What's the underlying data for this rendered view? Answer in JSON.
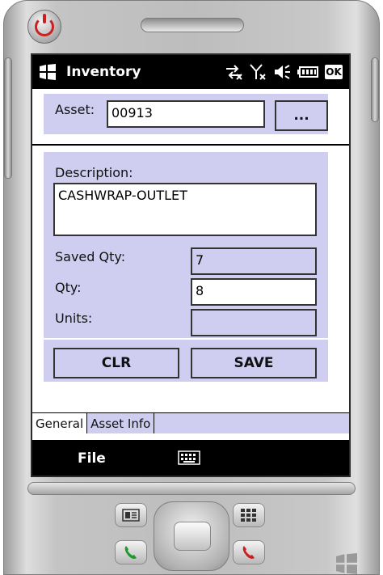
{
  "app": {
    "title": "Inventory",
    "ok_label": "OK"
  },
  "asset": {
    "label": "Asset:",
    "value": "00913",
    "browse_label": "..."
  },
  "description": {
    "label": "Description:",
    "value": "CASHWRAP-OUTLET"
  },
  "saved_qty": {
    "label": "Saved Qty:",
    "value": "7"
  },
  "qty": {
    "label": "Qty:",
    "value": "8"
  },
  "units": {
    "label": "Units:",
    "value": ""
  },
  "buttons": {
    "clr": "CLR",
    "save": "SAVE"
  },
  "tabs": [
    {
      "label": "General",
      "active": true
    },
    {
      "label": "Asset Info",
      "active": false
    }
  ],
  "softkeys": {
    "left": "File"
  },
  "colors": {
    "panel": "#cfcef0",
    "bar": "#000000",
    "power": "#cc2020"
  },
  "icons": [
    "windows-logo-icon",
    "connectivity-icon",
    "no-signal-icon",
    "volume-icon",
    "battery-icon",
    "keyboard-icon",
    "power-icon",
    "contacts-icon",
    "calendar-icon",
    "call-icon",
    "end-call-icon"
  ]
}
